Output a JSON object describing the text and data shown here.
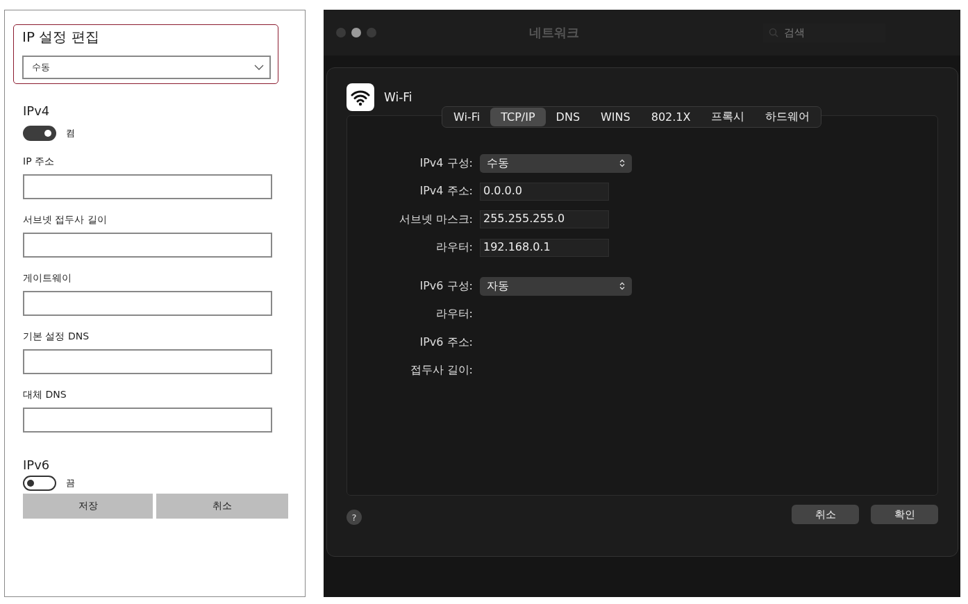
{
  "windows_panel": {
    "title": "IP 설정 편집",
    "mode_select": {
      "value": "수동"
    },
    "ipv4": {
      "heading": "IPv4",
      "toggle": {
        "on": true,
        "label": "켬"
      },
      "fields": [
        {
          "label": "IP 주소"
        },
        {
          "label": "서브넷 접두사 길이"
        },
        {
          "label": "게이트웨이"
        },
        {
          "label": "기본 설정 DNS"
        },
        {
          "label": "대체 DNS"
        }
      ]
    },
    "ipv6": {
      "heading": "IPv6",
      "toggle": {
        "on": false,
        "label": "끔"
      }
    },
    "buttons": [
      "저장",
      "취소"
    ]
  },
  "mac_window": {
    "title": "네트워크",
    "search": {
      "placeholder": "검색"
    },
    "sheet": {
      "title": "Wi-Fi",
      "tabs": [
        {
          "label": "Wi-Fi",
          "selected": false
        },
        {
          "label": "TCP/IP",
          "selected": true
        },
        {
          "label": "DNS",
          "selected": false
        },
        {
          "label": "WINS",
          "selected": false
        },
        {
          "label": "802.1X",
          "selected": false
        },
        {
          "label": "프록시",
          "selected": false
        },
        {
          "label": "하드웨어",
          "selected": false
        }
      ],
      "rows": [
        {
          "kind": "popup",
          "label": "IPv4 구성:",
          "value": "수동"
        },
        {
          "kind": "field",
          "label": "IPv4 주소:",
          "value": "0.0.0.0"
        },
        {
          "kind": "field",
          "label": "서브넷 마스크:",
          "value": "255.255.255.0"
        },
        {
          "kind": "field",
          "label": "라우터:",
          "value": "192.168.0.1"
        },
        {
          "kind": "spacer"
        },
        {
          "kind": "popup",
          "label": "IPv6 구성:",
          "value": "자동"
        },
        {
          "kind": "text",
          "label": "라우터:"
        },
        {
          "kind": "text",
          "label": "IPv6 주소:"
        },
        {
          "kind": "text",
          "label": "접두사 길이:"
        }
      ],
      "help": "?",
      "buttons": [
        "취소",
        "확인"
      ]
    }
  }
}
